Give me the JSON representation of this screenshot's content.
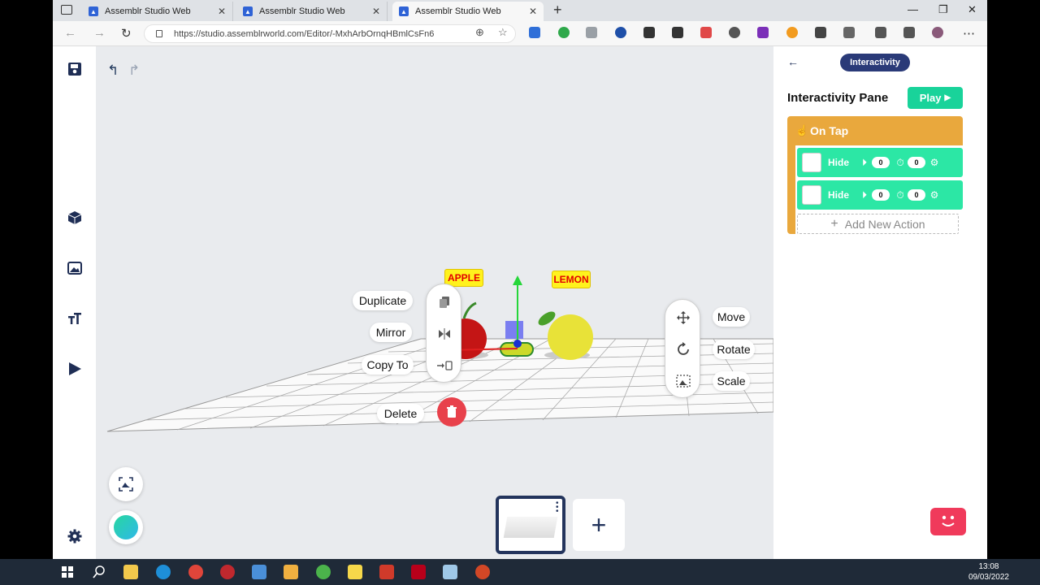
{
  "browser": {
    "tabs": [
      {
        "title": "Assemblr Studio Web",
        "close": "✕"
      },
      {
        "title": "Assemblr Studio Web",
        "close": "✕"
      },
      {
        "title": "Assemblr Studio Web",
        "close": "✕"
      }
    ],
    "new_tab": "+",
    "url": "https://studio.assemblrworld.com/Editor/-MxhArbOrnqHBmlCsFn6",
    "window_controls": {
      "minimize": "—",
      "maximize": "❐",
      "close": "✕"
    },
    "menu": "⋯"
  },
  "editor": {
    "left_toolbar": [
      {
        "name": "save-icon",
        "glyph": "💾"
      },
      {
        "name": "object-cube-icon",
        "glyph": "⬢"
      },
      {
        "name": "image-icon",
        "glyph": "🖼"
      },
      {
        "name": "text-icon",
        "glyph": "TT"
      },
      {
        "name": "play-triangle-icon",
        "glyph": "▶"
      },
      {
        "name": "settings-gear-icon",
        "glyph": "⚙"
      }
    ],
    "undo": "↰",
    "redo": "↱",
    "object_menu": {
      "duplicate": "Duplicate",
      "mirror": "Mirror",
      "copy_to": "Copy To",
      "delete": "Delete"
    },
    "transform_menu": {
      "move": "Move",
      "rotate": "Rotate",
      "scale": "Scale"
    },
    "fruit_labels": {
      "apple": "APPLE",
      "lemon": "LEMON"
    },
    "add_scene": "+"
  },
  "interactivity_panel": {
    "back": "←",
    "badge": "Interactivity",
    "title": "Interactivity Pane",
    "play_label": "Play",
    "trigger": "On Tap",
    "actions": [
      {
        "label": "Hide",
        "delay": "0",
        "duration": "0"
      },
      {
        "label": "Hide",
        "delay": "0",
        "duration": "0"
      }
    ],
    "add_action": "Add New Action"
  },
  "taskbar": {
    "time": "13:08",
    "date": "09/03/2022"
  },
  "colors": {
    "navy": "#23345c",
    "ontap_orange": "#e9a83d",
    "action_green": "#2ce7a5",
    "play_green": "#19d39a",
    "delete_red": "#e8414b"
  }
}
